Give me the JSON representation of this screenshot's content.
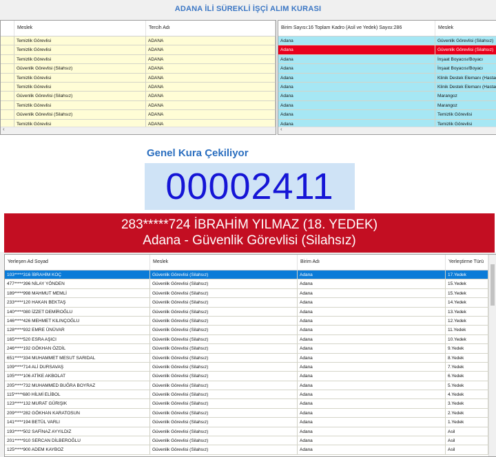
{
  "app": {
    "title": "ADANA İLİ SÜREKLİ İŞÇİ ALIM KURASI"
  },
  "left_grid": {
    "columns": [
      "Meslek",
      "Tercih Adı"
    ],
    "rows": [
      [
        "Temizlik Görevlisi",
        "ADANA"
      ],
      [
        "Temizlik Görevlisi",
        "ADANA"
      ],
      [
        "Temizlik Görevlisi",
        "ADANA"
      ],
      [
        "Güvenlik Görevlisi (Silahsız)",
        "ADANA"
      ],
      [
        "Temizlik Görevlisi",
        "ADANA"
      ],
      [
        "Temizlik Görevlisi",
        "ADANA"
      ],
      [
        "Güvenlik Görevlisi (Silahsız)",
        "ADANA"
      ],
      [
        "Temizlik Görevlisi",
        "ADANA"
      ],
      [
        "Güvenlik Görevlisi (Silahsız)",
        "ADANA"
      ],
      [
        "Temizlik Görevlisi",
        "ADANA"
      ]
    ]
  },
  "right_grid": {
    "columns": [
      "Birim Sayısı:16 Toplam Kadro (Asil ve Yedek) Sayısı:286",
      "Meslek"
    ],
    "rows": [
      [
        "Adana",
        "Güvenlik Görevlisi (Silahsız)"
      ],
      [
        "Adana",
        "Güvenlik Görevlisi (Silahsız)"
      ],
      [
        "Adana",
        "İnşaat Boyacısı/Boyacı"
      ],
      [
        "Adana",
        "İnşaat Boyacısı/Boyacı"
      ],
      [
        "Adana",
        "Klinik Destek Elemanı (Hastan"
      ],
      [
        "Adana",
        "Klinik Destek Elemanı (Hastan"
      ],
      [
        "Adana",
        "Marangoz"
      ],
      [
        "Adana",
        "Marangoz"
      ],
      [
        "Adana",
        "Temizlik Görevlisi"
      ],
      [
        "Adana",
        "Temizlik Görevlisi"
      ]
    ],
    "highlight_row": 1
  },
  "draw": {
    "subtitle": "Genel Kura Çekiliyor",
    "number": "00002411",
    "winner_line1": "283*****724 İBRAHİM YILMAZ (18. YEDEK)",
    "winner_line2": "Adana - Güvenlik Görevlisi (Silahsız)"
  },
  "results": {
    "columns": [
      "Yerleşen Ad Soyad",
      "Meslek",
      "Birim Adı",
      "Yerleştirme Türü"
    ],
    "rows": [
      [
        "103*****316 İBRAHİM KOÇ",
        "Güvenlik Görevlisi (Silahsız)",
        "Adana",
        "17.Yedek"
      ],
      [
        "477*****396 NİLAY YÖNDEN",
        "Güvenlik Görevlisi (Silahsız)",
        "Adana",
        "15.Yedek"
      ],
      [
        "189*****998 MAHMUT MEMLİ",
        "Güvenlik Görevlisi (Silahsız)",
        "Adana",
        "15.Yedek"
      ],
      [
        "233*****120 HAKAN BEKTAŞ",
        "Güvenlik Görevlisi (Silahsız)",
        "Adana",
        "14.Yedek"
      ],
      [
        "140*****080 İZZET DEMİROĞLU",
        "Güvenlik Görevlisi (Silahsız)",
        "Adana",
        "13.Yedek"
      ],
      [
        "146*****426 MEHMET KILINÇOĞLU",
        "Güvenlik Görevlisi (Silahsız)",
        "Adana",
        "12.Yedek"
      ],
      [
        "128*****932 EMRE ÜNÜVAR",
        "Güvenlik Görevlisi (Silahsız)",
        "Adana",
        "11.Yedek"
      ],
      [
        "165*****520 ESRA AŞICI",
        "Güvenlik Görevlisi (Silahsız)",
        "Adana",
        "10.Yedek"
      ],
      [
        "246*****192 GÖKHAN ÖZDİL",
        "Güvenlik Görevlisi (Silahsız)",
        "Adana",
        "9.Yedek"
      ],
      [
        "651*****334 MUHAMMET MESUT SARIDAL",
        "Güvenlik Görevlisi (Silahsız)",
        "Adana",
        "8.Yedek"
      ],
      [
        "109*****714 ALİ DURSAVAŞ",
        "Güvenlik Görevlisi (Silahsız)",
        "Adana",
        "7.Yedek"
      ],
      [
        "105*****106 ATİKE AKBOLAT",
        "Güvenlik Görevlisi (Silahsız)",
        "Adana",
        "6.Yedek"
      ],
      [
        "205*****732 MUHAMMED BUĞRA BOYRAZ",
        "Güvenlik Görevlisi (Silahsız)",
        "Adana",
        "5.Yedek"
      ],
      [
        "115*****680 HİLMİ ELİBOL",
        "Güvenlik Görevlisi (Silahsız)",
        "Adana",
        "4.Yedek"
      ],
      [
        "123*****132 MURAT GÜRIŞIK",
        "Güvenlik Görevlisi (Silahsız)",
        "Adana",
        "3.Yedek"
      ],
      [
        "209*****282 GÖKHAN KARATOSUN",
        "Güvenlik Görevlisi (Silahsız)",
        "Adana",
        "2.Yedek"
      ],
      [
        "141*****194 BETÜL VARLI",
        "Güvenlik Görevlisi (Silahsız)",
        "Adana",
        "1.Yedek"
      ],
      [
        "193*****502 SAFİNAZ AYYILDIZ",
        "Güvenlik Görevlisi (Silahsız)",
        "Adana",
        "Asil"
      ],
      [
        "201*****910 SERCAN DİLBEROĞLU",
        "Güvenlik Görevlisi (Silahsız)",
        "Adana",
        "Asil"
      ],
      [
        "125*****900 ADEM KAYBOZ",
        "Güvenlik Görevlisi (Silahsız)",
        "Adana",
        "Asil"
      ]
    ],
    "highlight_row": 0
  },
  "colors": {
    "left_rows": "#fffdd6",
    "right_rows": "#a6e7f4",
    "selected_red": "#e8001c",
    "banner": "#c30e22",
    "number": "#1515d6",
    "selected_blue": "#0a7bd8"
  }
}
